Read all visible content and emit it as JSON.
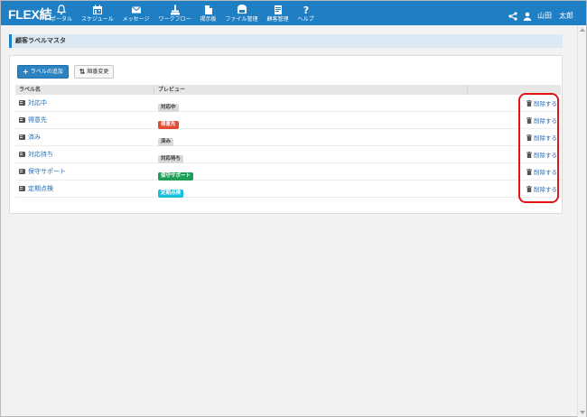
{
  "app": {
    "brand": "FLEX結"
  },
  "nav": [
    {
      "label": "ポータル",
      "icon": "bell-icon"
    },
    {
      "label": "スケジュール",
      "icon": "calendar-icon"
    },
    {
      "label": "メッセージ",
      "icon": "envelope-icon"
    },
    {
      "label": "ワークフロー",
      "icon": "workflow-icon"
    },
    {
      "label": "掲示板",
      "icon": "bulletin-icon"
    },
    {
      "label": "ファイル管理",
      "icon": "folder-icon"
    },
    {
      "label": "顧客管理",
      "icon": "customer-icon"
    },
    {
      "label": "ヘルプ",
      "icon": "help-icon"
    }
  ],
  "user": {
    "name": "山田　太郎"
  },
  "page": {
    "title": "顧客ラベルマスタ"
  },
  "toolbar": {
    "add_label": "ラベルの追加",
    "reorder_label": "順番変更"
  },
  "table": {
    "columns": [
      "ラベル名",
      "プレビュー",
      ""
    ],
    "rows": [
      {
        "name": "対応中",
        "preview": "対応中",
        "bg": "#d9d9d9",
        "fg": "#333333",
        "action": "削除する"
      },
      {
        "name": "得意先",
        "preview": "得意先",
        "bg": "#e14b32",
        "fg": "#ffffff",
        "action": "削除する"
      },
      {
        "name": "済み",
        "preview": "済み",
        "bg": "#d9d9d9",
        "fg": "#333333",
        "action": "削除する"
      },
      {
        "name": "対応待ち",
        "preview": "対応待ち",
        "bg": "#d9d9d9",
        "fg": "#333333",
        "action": "削除する"
      },
      {
        "name": "保守サポート",
        "preview": "保守サポート",
        "bg": "#1e9e57",
        "fg": "#ffffff",
        "action": "削除する"
      },
      {
        "name": "定期点検",
        "preview": "定期点検",
        "bg": "#15c0d9",
        "fg": "#ffffff",
        "action": "削除する"
      }
    ]
  },
  "colors": {
    "topbar": "#1f7fc4",
    "link": "#2a6db5",
    "highlight": "#e31414"
  }
}
